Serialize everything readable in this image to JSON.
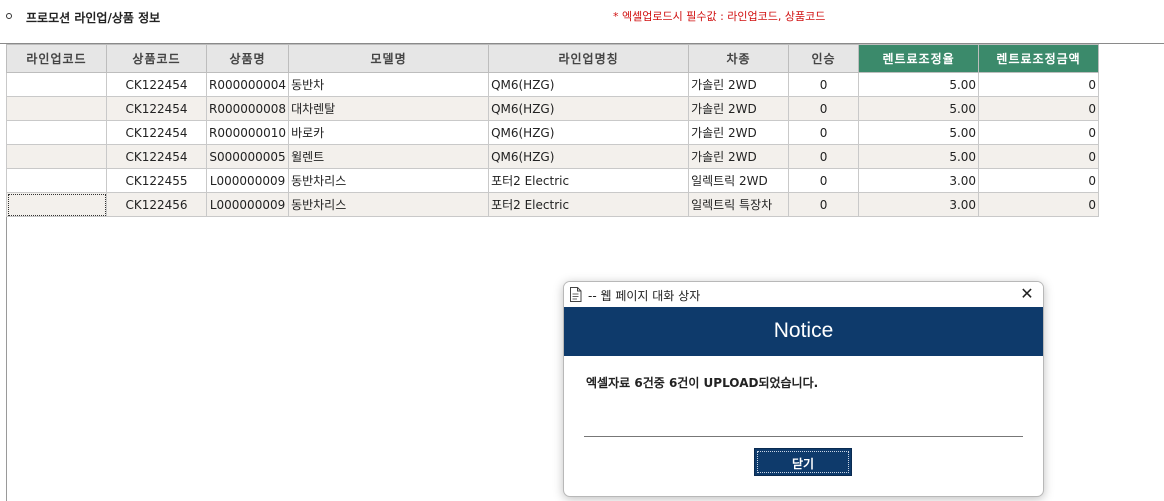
{
  "section": {
    "title": "프로모션 라인업/상품 정보",
    "upload_note": "* 엑셀업로드시 필수값 : 라인업코드, 상품코드"
  },
  "grid": {
    "columns": [
      "라인업코드",
      "상품코드",
      "상품명",
      "모델명",
      "라인업명칭",
      "차종",
      "인승",
      "렌트료조정율",
      "렌트료조정금액"
    ],
    "accent_color": "#3b8a6b",
    "rows": [
      {
        "lineup_code": "",
        "product_code": "CK122454",
        "product_name": "R000000004",
        "model_name": "동반차",
        "lineup_name": "QM6(HZG)",
        "vehicle_type": "가솔린 2WD",
        "seats": "0",
        "rent_rate": "5.00",
        "rent_amount": "0"
      },
      {
        "lineup_code": "",
        "product_code": "CK122454",
        "product_name": "R000000008",
        "model_name": "대차렌탈",
        "lineup_name": "QM6(HZG)",
        "vehicle_type": "가솔린 2WD",
        "seats": "0",
        "rent_rate": "5.00",
        "rent_amount": "0"
      },
      {
        "lineup_code": "",
        "product_code": "CK122454",
        "product_name": "R000000010",
        "model_name": "바로카",
        "lineup_name": "QM6(HZG)",
        "vehicle_type": "가솔린 2WD",
        "seats": "0",
        "rent_rate": "5.00",
        "rent_amount": "0"
      },
      {
        "lineup_code": "",
        "product_code": "CK122454",
        "product_name": "S000000005",
        "model_name": "윌렌트",
        "lineup_name": "QM6(HZG)",
        "vehicle_type": "가솔린 2WD",
        "seats": "0",
        "rent_rate": "5.00",
        "rent_amount": "0"
      },
      {
        "lineup_code": "",
        "product_code": "CK122455",
        "product_name": "L000000009",
        "model_name": "동반차리스",
        "lineup_name": "포터2 Electric",
        "vehicle_type": "일렉트릭 2WD",
        "seats": "0",
        "rent_rate": "3.00",
        "rent_amount": "0"
      },
      {
        "lineup_code": "",
        "product_code": "CK122456",
        "product_name": "L000000009",
        "model_name": "동반차리스",
        "lineup_name": "포터2 Electric",
        "vehicle_type": "일렉트릭 특장차",
        "seats": "0",
        "rent_rate": "3.00",
        "rent_amount": "0"
      }
    ]
  },
  "dialog": {
    "window_title": "-- 웹 페이지 대화 상자",
    "close_glyph": "✕",
    "banner": "Notice",
    "banner_color": "#0e3a6b",
    "message": "엑셀자료 6건중 6건이 UPLOAD되었습니다.",
    "button_label": "닫기",
    "icons": {
      "title": "document-icon",
      "close": "close-icon"
    }
  }
}
